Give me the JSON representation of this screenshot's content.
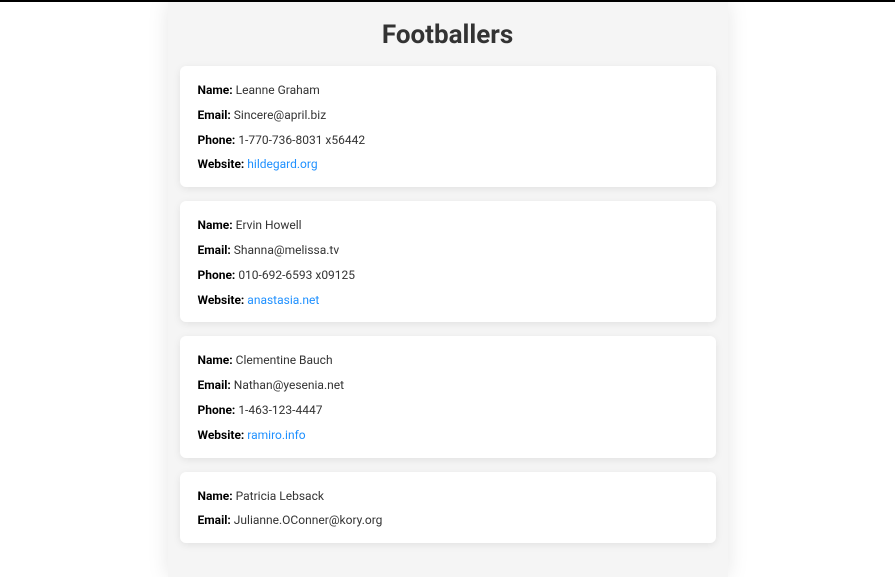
{
  "title": "Footballers",
  "labels": {
    "name": "Name:",
    "email": "Email:",
    "phone": "Phone:",
    "website": "Website:"
  },
  "people": [
    {
      "name": "Leanne Graham",
      "email": "Sincere@april.biz",
      "phone": "1-770-736-8031 x56442",
      "website": "hildegard.org"
    },
    {
      "name": "Ervin Howell",
      "email": "Shanna@melissa.tv",
      "phone": "010-692-6593 x09125",
      "website": "anastasia.net"
    },
    {
      "name": "Clementine Bauch",
      "email": "Nathan@yesenia.net",
      "phone": "1-463-123-4447",
      "website": "ramiro.info"
    },
    {
      "name": "Patricia Lebsack",
      "email": "Julianne.OConner@kory.org",
      "phone": "",
      "website": ""
    }
  ]
}
